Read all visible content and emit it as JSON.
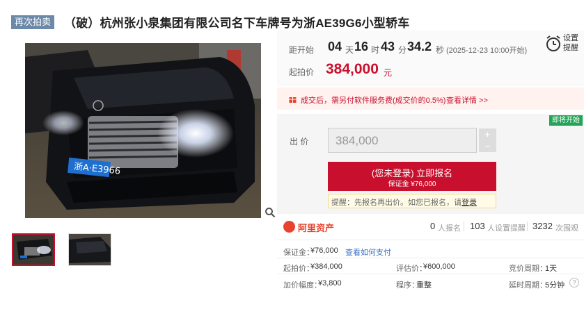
{
  "header": {
    "tag": "再次拍卖",
    "title": "（破）杭州张小泉集团有限公司名下车牌号为浙AE39G6小型轿车"
  },
  "gallery": {
    "plate_text": "浙A·E3966"
  },
  "countdown": {
    "label": "距开始",
    "days": "04",
    "days_unit": "天",
    "hours": "16",
    "hours_unit": "时",
    "minutes": "43",
    "minutes_unit": "分",
    "seconds": "34.2",
    "seconds_unit": "秒",
    "start_time": "(2025-12-23 10:00开始)"
  },
  "start_price": {
    "label": "起拍价",
    "value": "384,000",
    "unit": "元"
  },
  "remind": {
    "label": "设置提醒"
  },
  "notice": {
    "text": "成交后，需另付软件服务费(成交价的0.5%)",
    "link": "查看详情 >>"
  },
  "badge": "即将开始",
  "bid": {
    "label": "出  价",
    "value": "384,000",
    "plus": "+",
    "minus": "−",
    "signup_main": "(您未登录) 立即报名",
    "signup_sub": "保证金 ¥76,000",
    "tip_prefix": "提醒：先报名再出价。如您已报名，请",
    "tip_link": "登录"
  },
  "stats": {
    "logo": "阿里资产",
    "signup_count": "0",
    "signup_label": "人报名",
    "remind_count": "103",
    "remind_label": "人设置提醒",
    "view_count": "3232",
    "view_label": "次围观"
  },
  "info": {
    "deposit_label": "保证金：",
    "deposit_value": "¥76,000",
    "deposit_link": "查看如何支付",
    "start_label": "起拍价：",
    "start_value": "¥384,000",
    "eval_label": "评估价：",
    "eval_value": "¥600,000",
    "cycle_label": "竞价周期：",
    "cycle_value": "1天",
    "step_label": "加价幅度：",
    "step_value": "¥3,800",
    "proc_label": "程序：",
    "proc_value": "重整",
    "delay_label": "延时周期：",
    "delay_value": "5分钟",
    "help": "?"
  }
}
